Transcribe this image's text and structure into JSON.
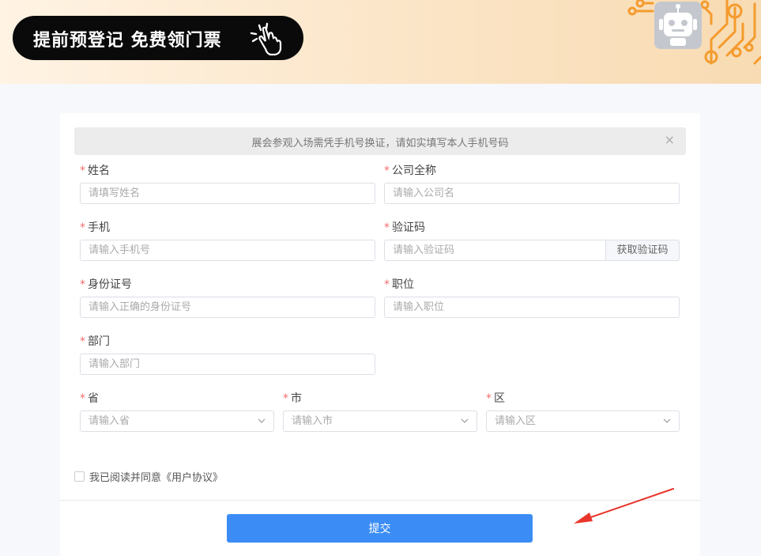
{
  "banner": {
    "title": "提前预登记 免费领门票",
    "hand_icon": "click-hand-icon",
    "robot_icon": "robot-icon",
    "accent": "#f49b2d"
  },
  "notice": {
    "text": "展会参观入场需凭手机号换证，请如实填写本人手机号码",
    "close_icon": "close-icon",
    "close_glyph": "×"
  },
  "form": {
    "required_mark": "*",
    "name": {
      "label": "姓名",
      "placeholder": "请填写姓名",
      "value": ""
    },
    "company": {
      "label": "公司全称",
      "placeholder": "请输入公司名",
      "value": ""
    },
    "phone": {
      "label": "手机",
      "placeholder": "请输入手机号",
      "value": ""
    },
    "code": {
      "label": "验证码",
      "placeholder": "请输入验证码",
      "value": "",
      "button": "获取验证码"
    },
    "id_card": {
      "label": "身份证号",
      "placeholder": "请输入正确的身份证号",
      "value": ""
    },
    "position": {
      "label": "职位",
      "placeholder": "请输入职位",
      "value": ""
    },
    "department": {
      "label": "部门",
      "placeholder": "请输入部门",
      "value": ""
    },
    "province": {
      "label": "省",
      "placeholder": "请输入省",
      "value": ""
    },
    "city": {
      "label": "市",
      "placeholder": "请输入市",
      "value": ""
    },
    "district": {
      "label": "区",
      "placeholder": "请输入区",
      "value": ""
    },
    "agreement": {
      "text": "我已阅读并同意《用户协议》",
      "checked": false
    },
    "submit": "提交"
  },
  "colors": {
    "primary": "#3b8df5",
    "required": "#f56c6c",
    "annotation_arrow": "#e8362c"
  }
}
